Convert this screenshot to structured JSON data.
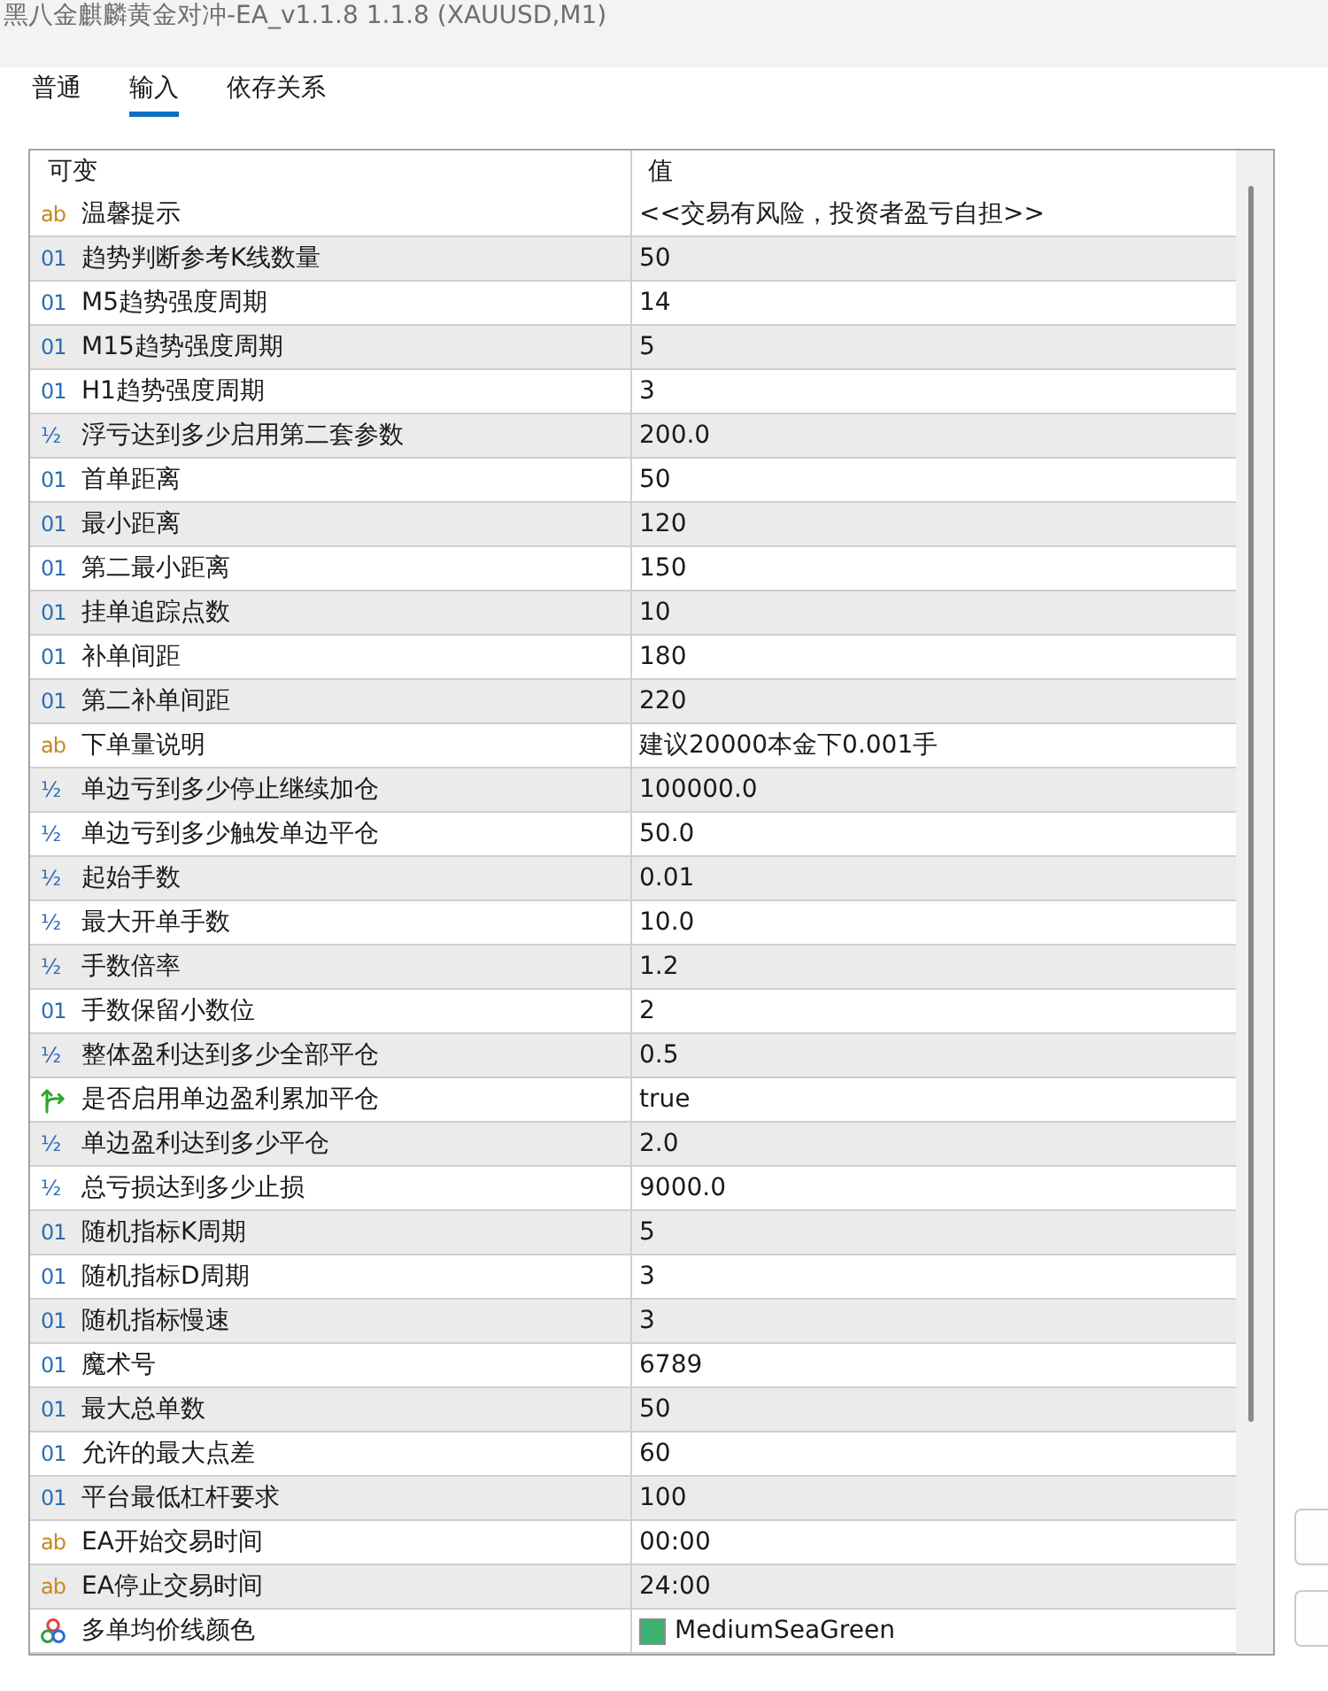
{
  "window": {
    "title": "黑八金麒麟黄金对冲-EA_v1.1.8 1.1.8 (XAUUSD,M1)"
  },
  "tabs": [
    {
      "label": "普通",
      "selected": false
    },
    {
      "label": "输入",
      "selected": true
    },
    {
      "label": "依存关系",
      "selected": false
    }
  ],
  "table": {
    "columns": [
      "可变",
      "值"
    ],
    "rows": [
      {
        "kind": "string",
        "icon": "ab",
        "name": "温馨提示",
        "value": "<<交易有风险，投资者盈亏自担>>"
      },
      {
        "kind": "int",
        "icon": "01",
        "name": "趋势判断参考K线数量",
        "value": "50"
      },
      {
        "kind": "int",
        "icon": "01",
        "name": "M5趋势强度周期",
        "value": "14"
      },
      {
        "kind": "int",
        "icon": "01",
        "name": "M15趋势强度周期",
        "value": "5"
      },
      {
        "kind": "int",
        "icon": "01",
        "name": "H1趋势强度周期",
        "value": "3"
      },
      {
        "kind": "double",
        "icon": "½",
        "name": "浮亏达到多少启用第二套参数",
        "value": "200.0"
      },
      {
        "kind": "int",
        "icon": "01",
        "name": "首单距离",
        "value": "50"
      },
      {
        "kind": "int",
        "icon": "01",
        "name": "最小距离",
        "value": "120"
      },
      {
        "kind": "int",
        "icon": "01",
        "name": "第二最小距离",
        "value": "150"
      },
      {
        "kind": "int",
        "icon": "01",
        "name": "挂单追踪点数",
        "value": "10"
      },
      {
        "kind": "int",
        "icon": "01",
        "name": "补单间距",
        "value": "180"
      },
      {
        "kind": "int",
        "icon": "01",
        "name": "第二补单间距",
        "value": "220"
      },
      {
        "kind": "string",
        "icon": "ab",
        "name": "下单量说明",
        "value": "建议20000本金下0.001手"
      },
      {
        "kind": "double",
        "icon": "½",
        "name": "单边亏到多少停止继续加仓",
        "value": "100000.0"
      },
      {
        "kind": "double",
        "icon": "½",
        "name": "单边亏到多少触发单边平仓",
        "value": "50.0"
      },
      {
        "kind": "double",
        "icon": "½",
        "name": "起始手数",
        "value": "0.01"
      },
      {
        "kind": "double",
        "icon": "½",
        "name": "最大开单手数",
        "value": "10.0"
      },
      {
        "kind": "double",
        "icon": "½",
        "name": "手数倍率",
        "value": "1.2"
      },
      {
        "kind": "int",
        "icon": "01",
        "name": "手数保留小数位",
        "value": "2"
      },
      {
        "kind": "double",
        "icon": "½",
        "name": "整体盈利达到多少全部平仓",
        "value": "0.5"
      },
      {
        "kind": "bool",
        "name": "是否启用单边盈利累加平仓",
        "value": "true"
      },
      {
        "kind": "double",
        "icon": "½",
        "name": "单边盈利达到多少平仓",
        "value": "2.0"
      },
      {
        "kind": "double",
        "icon": "½",
        "name": "总亏损达到多少止损",
        "value": "9000.0"
      },
      {
        "kind": "int",
        "icon": "01",
        "name": "随机指标K周期",
        "value": "5"
      },
      {
        "kind": "int",
        "icon": "01",
        "name": "随机指标D周期",
        "value": "3"
      },
      {
        "kind": "int",
        "icon": "01",
        "name": "随机指标慢速",
        "value": "3"
      },
      {
        "kind": "int",
        "icon": "01",
        "name": "魔术号",
        "value": "6789"
      },
      {
        "kind": "int",
        "icon": "01",
        "name": "最大总单数",
        "value": "50"
      },
      {
        "kind": "int",
        "icon": "01",
        "name": "允许的最大点差",
        "value": "60"
      },
      {
        "kind": "int",
        "icon": "01",
        "name": "平台最低杠杆要求",
        "value": "100"
      },
      {
        "kind": "string",
        "icon": "ab",
        "name": "EA开始交易时间",
        "value": "00:00"
      },
      {
        "kind": "string",
        "icon": "ab",
        "name": "EA停止交易时间",
        "value": "24:00"
      },
      {
        "kind": "color",
        "name": "多单均价线颜色",
        "value": "MediumSeaGreen",
        "color": "#3cb371"
      }
    ]
  }
}
